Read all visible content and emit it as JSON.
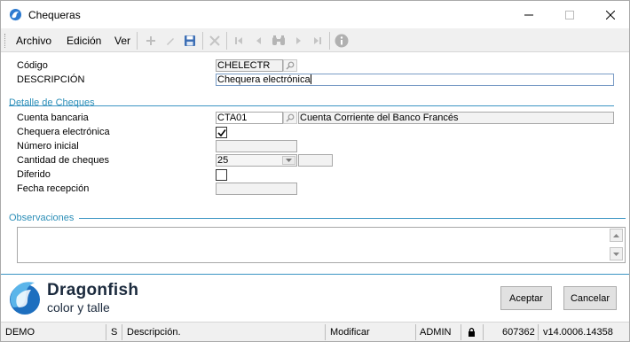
{
  "window": {
    "title": "Chequeras"
  },
  "menu": {
    "archivo": "Archivo",
    "edicion": "Edición",
    "ver": "Ver"
  },
  "toolbar": {
    "icons": [
      "add-icon",
      "edit-icon",
      "save-icon",
      "delete-icon",
      "first-record-icon",
      "previous-record-icon",
      "binoculars-icon",
      "next-record-icon",
      "last-record-icon",
      "info-icon"
    ]
  },
  "form": {
    "codigo_label": "Código",
    "codigo_value": "CHELECTR",
    "descripcion_label": "DESCRIPCIÓN",
    "descripcion_value": "Chequera electrónica",
    "detalle_section": "Detalle de Cheques",
    "cuenta_label": "Cuenta bancaria",
    "cuenta_value": "CTA01",
    "cuenta_desc": "Cuenta Corriente del Banco Francés",
    "electronica_label": "Chequera electrónica",
    "electronica_checked": true,
    "numero_label": "Número inicial",
    "numero_value": "",
    "cantidad_label": "Cantidad de cheques",
    "cantidad_value": "25",
    "diferido_label": "Diferido",
    "diferido_checked": false,
    "fecha_label": "Fecha recepción",
    "fecha_value": "",
    "observaciones_section": "Observaciones"
  },
  "brand": {
    "name": "Dragonfish",
    "tagline": "color y talle"
  },
  "buttons": {
    "accept": "Aceptar",
    "cancel": "Cancelar"
  },
  "status": {
    "db": "DEMO",
    "s": "S",
    "descripcion": "Descripción.",
    "mode": "Modificar",
    "user": "ADMIN",
    "serial": "607362",
    "version": "v14.0006.14358"
  },
  "colors": {
    "accent": "#3b95c3",
    "section_text": "#2d8fb8"
  }
}
